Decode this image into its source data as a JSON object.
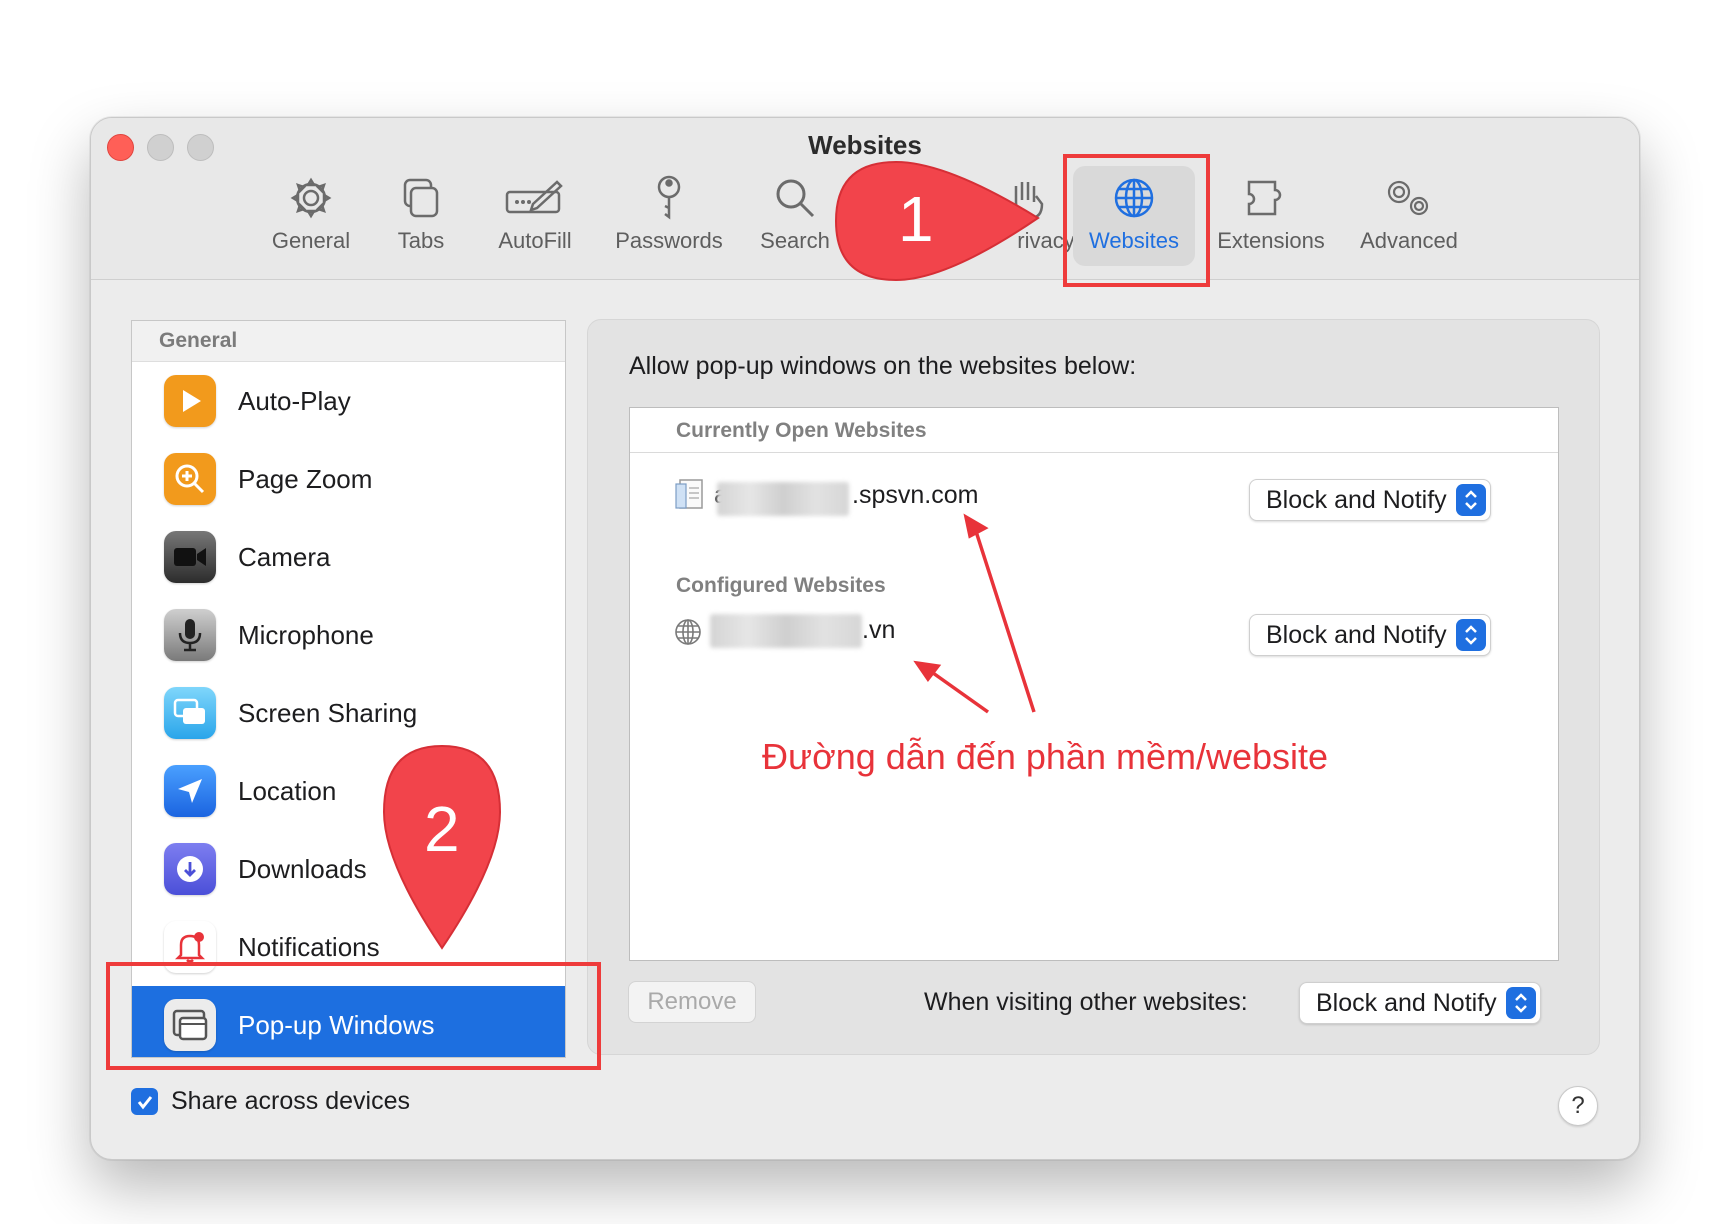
{
  "window": {
    "title": "Websites"
  },
  "toolbar": {
    "tabs": [
      {
        "label": "General",
        "icon": "gear-icon"
      },
      {
        "label": "Tabs",
        "icon": "tabs-icon"
      },
      {
        "label": "AutoFill",
        "icon": "autofill-icon"
      },
      {
        "label": "Passwords",
        "icon": "key-icon"
      },
      {
        "label": "Search",
        "icon": "search-icon"
      },
      {
        "label": "rivacy",
        "icon": "hand-icon"
      },
      {
        "label": "Websites",
        "icon": "globe-icon",
        "active": true
      },
      {
        "label": "Extensions",
        "icon": "puzzle-icon"
      },
      {
        "label": "Advanced",
        "icon": "gears-icon"
      }
    ]
  },
  "sidebar": {
    "header": "General",
    "items": [
      {
        "label": "Auto-Play",
        "icon": "play-icon",
        "color": "#f29a1c"
      },
      {
        "label": "Page Zoom",
        "icon": "zoom-icon",
        "color": "#f29a1c"
      },
      {
        "label": "Camera",
        "icon": "camera-icon",
        "color": "#3a3a3a"
      },
      {
        "label": "Microphone",
        "icon": "microphone-icon",
        "color": "#8e8e8e"
      },
      {
        "label": "Screen Sharing",
        "icon": "screen-sharing-icon",
        "color": "#41b8f0"
      },
      {
        "label": "Location",
        "icon": "location-icon",
        "color": "#2a7cf0"
      },
      {
        "label": "Downloads",
        "icon": "download-icon",
        "color": "#5a5ee6"
      },
      {
        "label": "Notifications",
        "icon": "bell-icon",
        "color": "#ffffff"
      },
      {
        "label": "Pop-up Windows",
        "icon": "popup-windows-icon",
        "color": "#e8e8e8",
        "selected": true
      }
    ]
  },
  "main": {
    "title": "Allow pop-up windows on the websites below:",
    "open_header": "Currently Open Websites",
    "open_site": {
      "suffix": ".spsvn.com",
      "prefix_visible": "a",
      "setting": "Block and Notify"
    },
    "configured_header": "Configured Websites",
    "configured_site": {
      "suffix": ".vn",
      "setting": "Block and Notify"
    },
    "remove_label": "Remove",
    "other_label": "When visiting other websites:",
    "other_setting": "Block and Notify",
    "annotation": "Đường dẫn đến phần mềm/website"
  },
  "footer": {
    "share_label": "Share across devices",
    "share_checked": true,
    "help_label": "?"
  },
  "markers": {
    "step1": "1",
    "step2": "2"
  },
  "colors": {
    "accent": "#1f6fe0",
    "highlight": "#ee3b3b",
    "marker": "#f2444b"
  }
}
